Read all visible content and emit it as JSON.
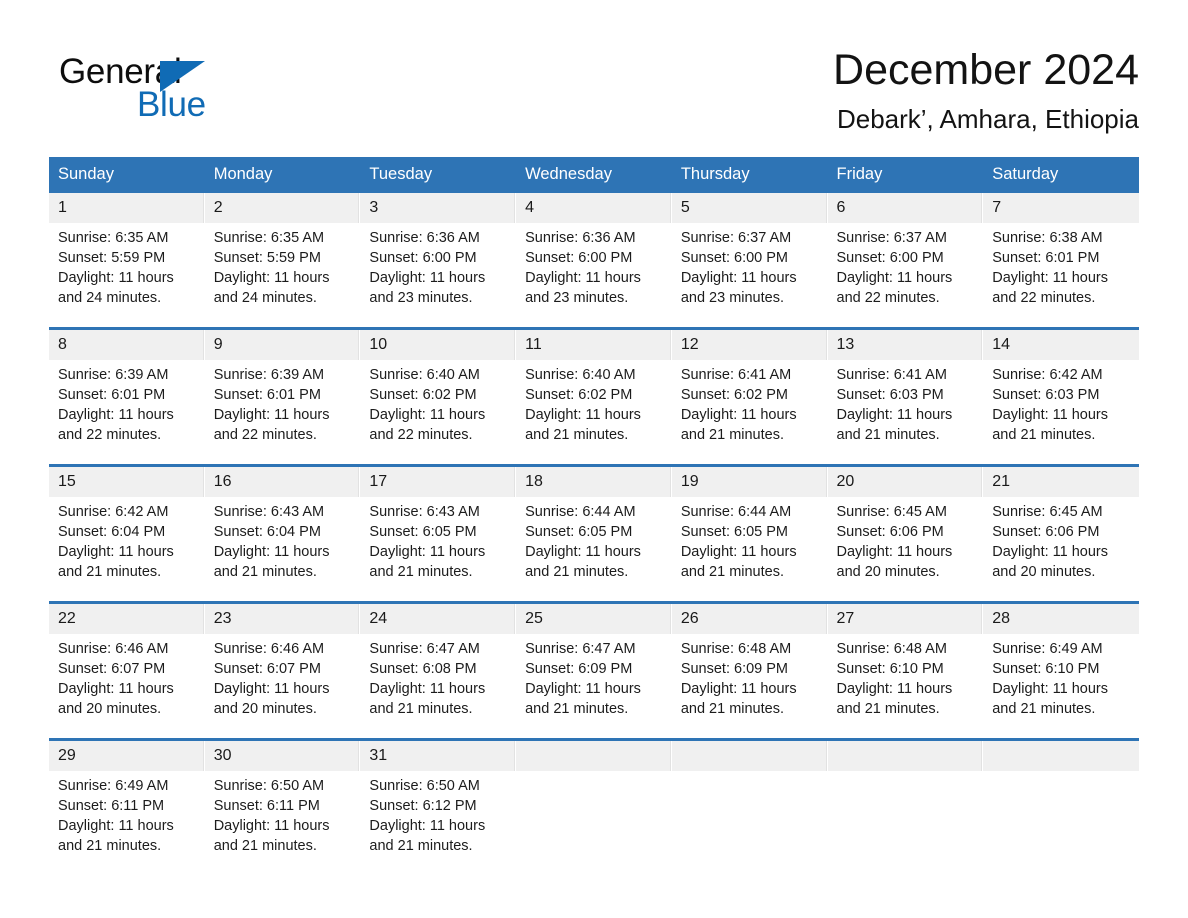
{
  "brand": {
    "name_part1": "General",
    "name_part2": "Blue",
    "logo_icon": "triangle-logo-icon"
  },
  "header": {
    "title": "December 2024",
    "subtitle": "Debark’, Amhara, Ethiopia"
  },
  "colors": {
    "header_blue": "#2e74b5",
    "brand_blue": "#106bb5",
    "daynum_band": "#f0f0f0",
    "text": "#1a1a1a"
  },
  "weekdays": [
    "Sunday",
    "Monday",
    "Tuesday",
    "Wednesday",
    "Thursday",
    "Friday",
    "Saturday"
  ],
  "weeks": [
    [
      {
        "day": "1",
        "sunrise": "Sunrise: 6:35 AM",
        "sunset": "Sunset: 5:59 PM",
        "daylight_line1": "Daylight: 11 hours",
        "daylight_line2": "and 24 minutes."
      },
      {
        "day": "2",
        "sunrise": "Sunrise: 6:35 AM",
        "sunset": "Sunset: 5:59 PM",
        "daylight_line1": "Daylight: 11 hours",
        "daylight_line2": "and 24 minutes."
      },
      {
        "day": "3",
        "sunrise": "Sunrise: 6:36 AM",
        "sunset": "Sunset: 6:00 PM",
        "daylight_line1": "Daylight: 11 hours",
        "daylight_line2": "and 23 minutes."
      },
      {
        "day": "4",
        "sunrise": "Sunrise: 6:36 AM",
        "sunset": "Sunset: 6:00 PM",
        "daylight_line1": "Daylight: 11 hours",
        "daylight_line2": "and 23 minutes."
      },
      {
        "day": "5",
        "sunrise": "Sunrise: 6:37 AM",
        "sunset": "Sunset: 6:00 PM",
        "daylight_line1": "Daylight: 11 hours",
        "daylight_line2": "and 23 minutes."
      },
      {
        "day": "6",
        "sunrise": "Sunrise: 6:37 AM",
        "sunset": "Sunset: 6:00 PM",
        "daylight_line1": "Daylight: 11 hours",
        "daylight_line2": "and 22 minutes."
      },
      {
        "day": "7",
        "sunrise": "Sunrise: 6:38 AM",
        "sunset": "Sunset: 6:01 PM",
        "daylight_line1": "Daylight: 11 hours",
        "daylight_line2": "and 22 minutes."
      }
    ],
    [
      {
        "day": "8",
        "sunrise": "Sunrise: 6:39 AM",
        "sunset": "Sunset: 6:01 PM",
        "daylight_line1": "Daylight: 11 hours",
        "daylight_line2": "and 22 minutes."
      },
      {
        "day": "9",
        "sunrise": "Sunrise: 6:39 AM",
        "sunset": "Sunset: 6:01 PM",
        "daylight_line1": "Daylight: 11 hours",
        "daylight_line2": "and 22 minutes."
      },
      {
        "day": "10",
        "sunrise": "Sunrise: 6:40 AM",
        "sunset": "Sunset: 6:02 PM",
        "daylight_line1": "Daylight: 11 hours",
        "daylight_line2": "and 22 minutes."
      },
      {
        "day": "11",
        "sunrise": "Sunrise: 6:40 AM",
        "sunset": "Sunset: 6:02 PM",
        "daylight_line1": "Daylight: 11 hours",
        "daylight_line2": "and 21 minutes."
      },
      {
        "day": "12",
        "sunrise": "Sunrise: 6:41 AM",
        "sunset": "Sunset: 6:02 PM",
        "daylight_line1": "Daylight: 11 hours",
        "daylight_line2": "and 21 minutes."
      },
      {
        "day": "13",
        "sunrise": "Sunrise: 6:41 AM",
        "sunset": "Sunset: 6:03 PM",
        "daylight_line1": "Daylight: 11 hours",
        "daylight_line2": "and 21 minutes."
      },
      {
        "day": "14",
        "sunrise": "Sunrise: 6:42 AM",
        "sunset": "Sunset: 6:03 PM",
        "daylight_line1": "Daylight: 11 hours",
        "daylight_line2": "and 21 minutes."
      }
    ],
    [
      {
        "day": "15",
        "sunrise": "Sunrise: 6:42 AM",
        "sunset": "Sunset: 6:04 PM",
        "daylight_line1": "Daylight: 11 hours",
        "daylight_line2": "and 21 minutes."
      },
      {
        "day": "16",
        "sunrise": "Sunrise: 6:43 AM",
        "sunset": "Sunset: 6:04 PM",
        "daylight_line1": "Daylight: 11 hours",
        "daylight_line2": "and 21 minutes."
      },
      {
        "day": "17",
        "sunrise": "Sunrise: 6:43 AM",
        "sunset": "Sunset: 6:05 PM",
        "daylight_line1": "Daylight: 11 hours",
        "daylight_line2": "and 21 minutes."
      },
      {
        "day": "18",
        "sunrise": "Sunrise: 6:44 AM",
        "sunset": "Sunset: 6:05 PM",
        "daylight_line1": "Daylight: 11 hours",
        "daylight_line2": "and 21 minutes."
      },
      {
        "day": "19",
        "sunrise": "Sunrise: 6:44 AM",
        "sunset": "Sunset: 6:05 PM",
        "daylight_line1": "Daylight: 11 hours",
        "daylight_line2": "and 21 minutes."
      },
      {
        "day": "20",
        "sunrise": "Sunrise: 6:45 AM",
        "sunset": "Sunset: 6:06 PM",
        "daylight_line1": "Daylight: 11 hours",
        "daylight_line2": "and 20 minutes."
      },
      {
        "day": "21",
        "sunrise": "Sunrise: 6:45 AM",
        "sunset": "Sunset: 6:06 PM",
        "daylight_line1": "Daylight: 11 hours",
        "daylight_line2": "and 20 minutes."
      }
    ],
    [
      {
        "day": "22",
        "sunrise": "Sunrise: 6:46 AM",
        "sunset": "Sunset: 6:07 PM",
        "daylight_line1": "Daylight: 11 hours",
        "daylight_line2": "and 20 minutes."
      },
      {
        "day": "23",
        "sunrise": "Sunrise: 6:46 AM",
        "sunset": "Sunset: 6:07 PM",
        "daylight_line1": "Daylight: 11 hours",
        "daylight_line2": "and 20 minutes."
      },
      {
        "day": "24",
        "sunrise": "Sunrise: 6:47 AM",
        "sunset": "Sunset: 6:08 PM",
        "daylight_line1": "Daylight: 11 hours",
        "daylight_line2": "and 21 minutes."
      },
      {
        "day": "25",
        "sunrise": "Sunrise: 6:47 AM",
        "sunset": "Sunset: 6:09 PM",
        "daylight_line1": "Daylight: 11 hours",
        "daylight_line2": "and 21 minutes."
      },
      {
        "day": "26",
        "sunrise": "Sunrise: 6:48 AM",
        "sunset": "Sunset: 6:09 PM",
        "daylight_line1": "Daylight: 11 hours",
        "daylight_line2": "and 21 minutes."
      },
      {
        "day": "27",
        "sunrise": "Sunrise: 6:48 AM",
        "sunset": "Sunset: 6:10 PM",
        "daylight_line1": "Daylight: 11 hours",
        "daylight_line2": "and 21 minutes."
      },
      {
        "day": "28",
        "sunrise": "Sunrise: 6:49 AM",
        "sunset": "Sunset: 6:10 PM",
        "daylight_line1": "Daylight: 11 hours",
        "daylight_line2": "and 21 minutes."
      }
    ],
    [
      {
        "day": "29",
        "sunrise": "Sunrise: 6:49 AM",
        "sunset": "Sunset: 6:11 PM",
        "daylight_line1": "Daylight: 11 hours",
        "daylight_line2": "and 21 minutes."
      },
      {
        "day": "30",
        "sunrise": "Sunrise: 6:50 AM",
        "sunset": "Sunset: 6:11 PM",
        "daylight_line1": "Daylight: 11 hours",
        "daylight_line2": "and 21 minutes."
      },
      {
        "day": "31",
        "sunrise": "Sunrise: 6:50 AM",
        "sunset": "Sunset: 6:12 PM",
        "daylight_line1": "Daylight: 11 hours",
        "daylight_line2": "and 21 minutes."
      },
      {
        "day": "",
        "sunrise": "",
        "sunset": "",
        "daylight_line1": "",
        "daylight_line2": ""
      },
      {
        "day": "",
        "sunrise": "",
        "sunset": "",
        "daylight_line1": "",
        "daylight_line2": ""
      },
      {
        "day": "",
        "sunrise": "",
        "sunset": "",
        "daylight_line1": "",
        "daylight_line2": ""
      },
      {
        "day": "",
        "sunrise": "",
        "sunset": "",
        "daylight_line1": "",
        "daylight_line2": ""
      }
    ]
  ]
}
